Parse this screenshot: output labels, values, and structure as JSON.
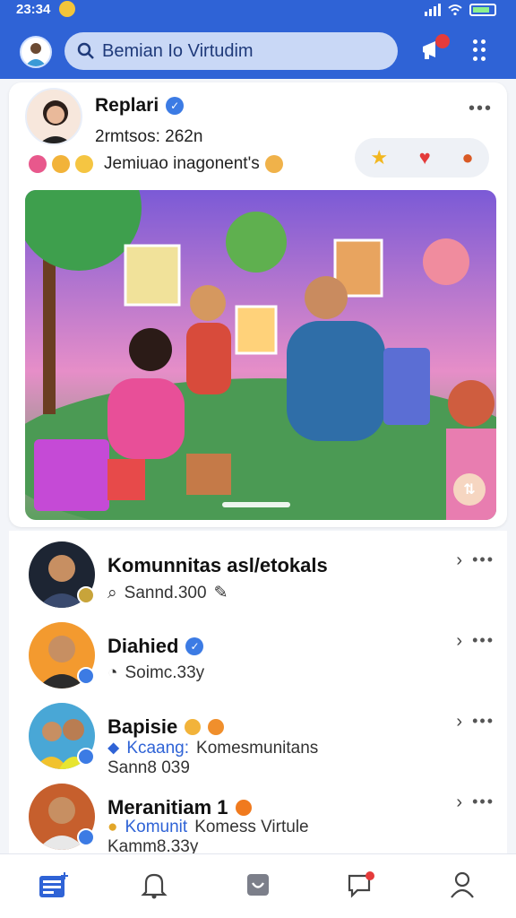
{
  "status": {
    "time": "23:34"
  },
  "header": {
    "search_text": "Bemian Io Virtudim"
  },
  "post": {
    "author": "Replari",
    "meta": "2rmtsos: 262n",
    "caption": "Jemiuao inagonent's"
  },
  "chats": [
    {
      "title": "Komunnitas asl/etokals",
      "sub": "Sannd.300"
    },
    {
      "title": "Diahied",
      "sub": "Soimc.33y"
    },
    {
      "title": "Bapisie",
      "sub_blue": "Kcaang:",
      "sub": "Komesmunitans",
      "sub2": "Sann8 039"
    },
    {
      "title": "Meranitiam 1",
      "sub_blue": "Komunit",
      "sub": "Komess Virtule",
      "sub2": "Kamm8.33y"
    }
  ],
  "colors": {
    "brand": "#2f63d6",
    "accent_red": "#e53b3b"
  }
}
